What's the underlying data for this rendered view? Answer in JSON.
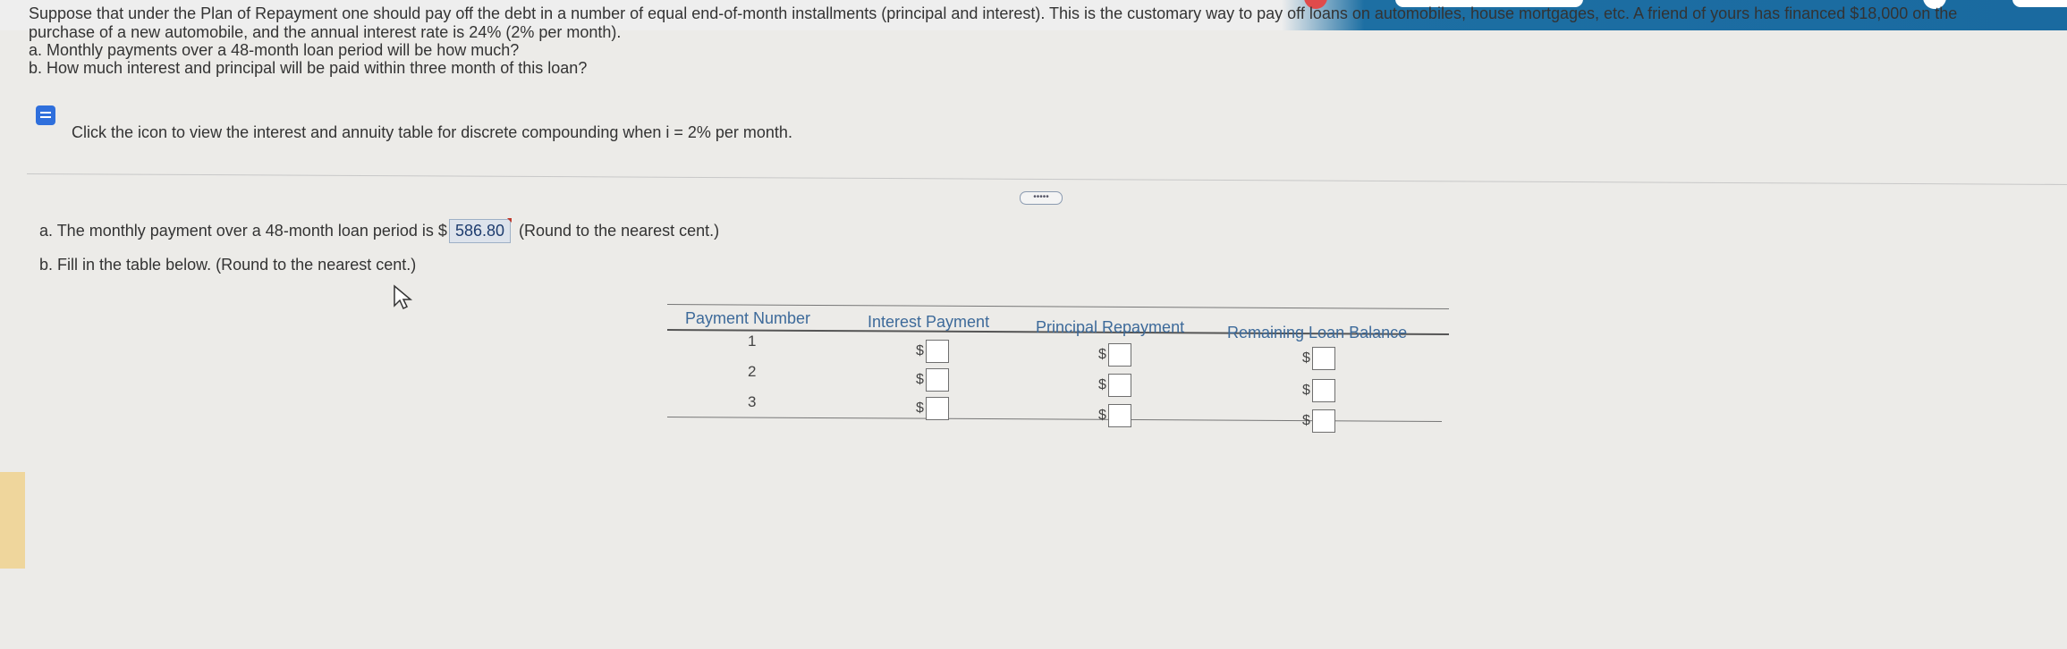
{
  "question": {
    "line1": "Suppose that under the Plan of Repayment one should pay off the debt in a number of equal end-of-month installments (principal and interest). This is the customary way to pay off loans on automobiles, house mortgages, etc. A friend of yours has financed $18,000 on the",
    "line2": "purchase of a new automobile, and the annual interest rate is 24% (2% per month).",
    "part_a": "a. Monthly payments over a 48-month loan period will be how much?",
    "part_b": "b. How much interest and principal will be paid within three month of this loan?"
  },
  "hint": {
    "icon": "document-icon",
    "text": "Click the icon to view the interest and annuity table for discrete compounding when i = 2% per month."
  },
  "expander_label": "•••••",
  "answer_a": {
    "prefix": "a. The monthly payment over a 48-month loan period is $",
    "value": "586.80",
    "suffix": "(Round to the nearest cent.)"
  },
  "answer_b": {
    "text": "b. Fill in the table below. (Round to the nearest cent.)"
  },
  "table": {
    "headers": [
      "Payment Number",
      "Interest Payment",
      "Principal Repayment",
      "Remaining Loan Balance"
    ],
    "rows": [
      {
        "number": "1",
        "interest": "$",
        "principal": "$",
        "balance": "$"
      },
      {
        "number": "2",
        "interest": "$",
        "principal": "$",
        "balance": "$"
      },
      {
        "number": "3",
        "interest": "$",
        "principal": "$",
        "balance": "$"
      }
    ]
  },
  "cursor": "pointer-cursor-icon"
}
